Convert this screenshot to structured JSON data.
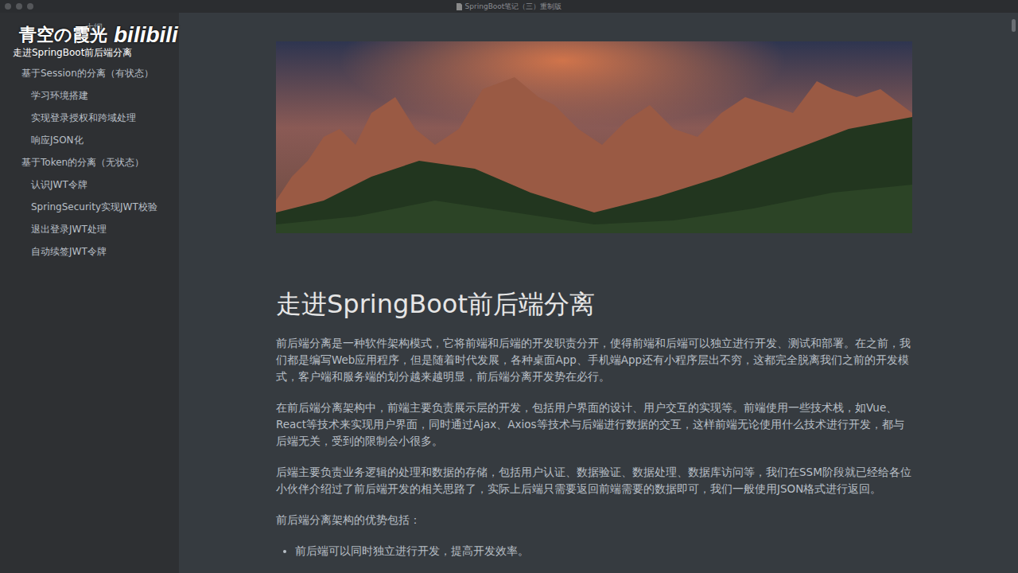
{
  "window": {
    "title": "SpringBoot笔记（三）重制版"
  },
  "watermark": {
    "name": "青空の霞光",
    "logo": "bilibili"
  },
  "sidebar": {
    "title": "大纲",
    "items": [
      {
        "label": "走进SpringBoot前后端分离",
        "kind": "h1",
        "selected": true
      },
      {
        "label": "基于Session的分离（有状态）",
        "kind": "h2",
        "selected": false
      },
      {
        "label": "学习环境搭建",
        "kind": "h3",
        "selected": false
      },
      {
        "label": "实现登录授权和跨域处理",
        "kind": "h3",
        "selected": false
      },
      {
        "label": "响应JSON化",
        "kind": "h3",
        "selected": false
      },
      {
        "label": "基于Token的分离（无状态）",
        "kind": "h2",
        "selected": false
      },
      {
        "label": "认识JWT令牌",
        "kind": "h3",
        "selected": false
      },
      {
        "label": "SpringSecurity实现JWT校验",
        "kind": "h3",
        "selected": false
      },
      {
        "label": "退出登录JWT处理",
        "kind": "h3",
        "selected": false
      },
      {
        "label": "自动续签JWT令牌",
        "kind": "h3",
        "selected": false
      }
    ]
  },
  "document": {
    "heading": "走进SpringBoot前后端分离",
    "paragraphs": [
      "前后端分离是一种软件架构模式，它将前端和后端的开发职责分开，使得前端和后端可以独立进行开发、测试和部署。在之前，我们都是编写Web应用程序，但是随着时代发展，各种桌面App、手机端App还有小程序层出不穷，这都完全脱离我们之前的开发模式，客户端和服务端的划分越来越明显，前后端分离开发势在必行。",
      "在前后端分离架构中，前端主要负责展示层的开发，包括用户界面的设计、用户交互的实现等。前端使用一些技术栈，如Vue、React等技术来实现用户界面，同时通过Ajax、Axios等技术与后端进行数据的交互，这样前端无论使用什么技术进行开发，都与后端无关，受到的限制会小很多。",
      "后端主要负责业务逻辑的处理和数据的存储，包括用户认证、数据验证、数据处理、数据库访问等，我们在SSM阶段就已经给各位小伙伴介绍过了前后端开发的相关思路了，实际上后端只需要返回前端需要的数据即可，我们一般使用JSON格式进行返回。",
      "前后端分离架构的优势包括："
    ],
    "list": [
      "前后端可以同时独立进行开发，提高开发效率。"
    ]
  }
}
